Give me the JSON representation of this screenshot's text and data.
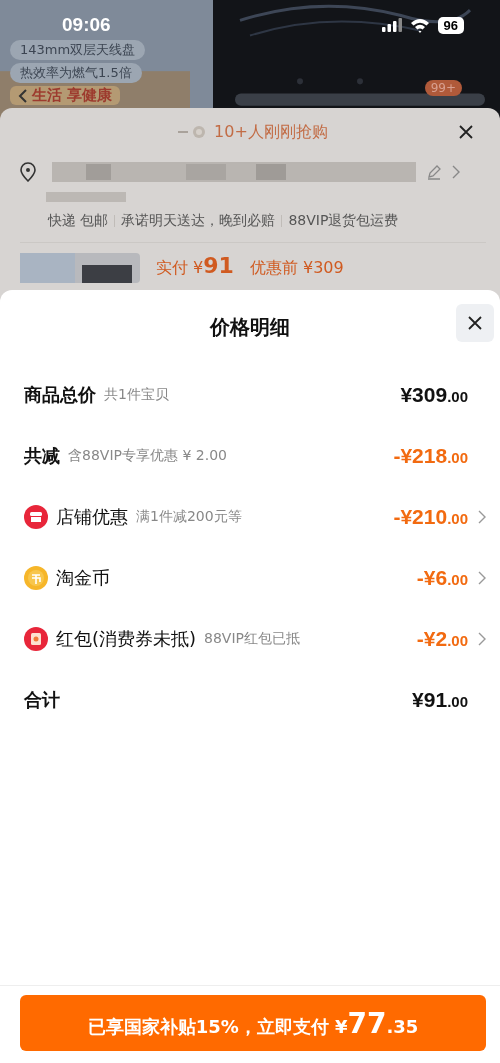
{
  "status_bar": {
    "time": "09:06",
    "battery": "96"
  },
  "background": {
    "promo_texts": [
      "143mm双层天线盘",
      "热效率为燃气1.5倍"
    ],
    "slogan": "生活 享健康",
    "badge": "99+",
    "sheet": {
      "buyers": "10+人刚刚抢购",
      "services": [
        "快递 包邮",
        "承诺明天送达，晚到必赔",
        "88VIP退货包运费"
      ],
      "paid_label": "实付 ¥",
      "paid": "91",
      "before": "优惠前 ¥309"
    }
  },
  "panel": {
    "title": "价格明细",
    "rows": [
      {
        "kind": "summary",
        "label": "商品总价",
        "note": "共1件宝贝",
        "amount": "¥309",
        "decimals": ".00",
        "has_details": false
      },
      {
        "kind": "reduction",
        "label": "共减",
        "note": "含88VIP专享优惠 ¥ 2.00",
        "amount": "-¥218",
        "decimals": ".00",
        "has_details": false
      },
      {
        "kind": "shop",
        "label": "店铺优惠",
        "note": "满1件减200元等",
        "amount": "-¥210",
        "decimals": ".00",
        "has_details": true
      },
      {
        "kind": "coin",
        "label": "淘金币",
        "amount": "-¥6",
        "decimals": ".00",
        "has_details": true
      },
      {
        "kind": "redpacket",
        "label": "红包(消费券未抵)",
        "note": "88VIP红包已抵",
        "amount": "-¥2",
        "decimals": ".00",
        "has_details": true
      },
      {
        "kind": "summary",
        "label": "合计",
        "amount": "¥91",
        "decimals": ".00",
        "has_details": false
      }
    ],
    "pay_button": {
      "label": "已享国家补贴15%，立即支付 ¥",
      "amount": "77",
      "decimals": ".35"
    }
  }
}
